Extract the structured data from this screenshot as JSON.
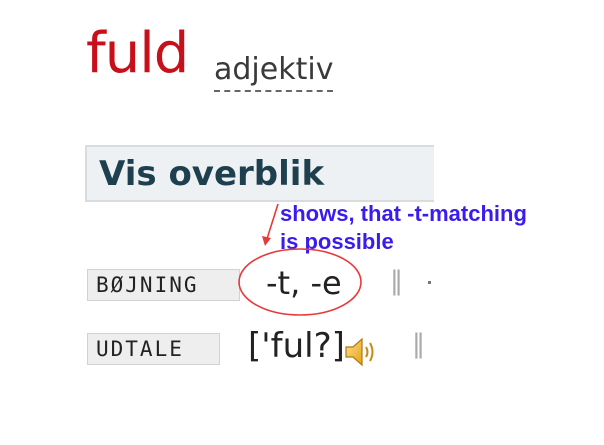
{
  "headword": "fuld",
  "part_of_speech": "adjektiv",
  "overview_button": "Vis overblik",
  "annotation": {
    "line1": "shows, that -t-matching",
    "line2": "is possible"
  },
  "rows": {
    "bojning": {
      "label": "BØJNING",
      "value": "-t, -e"
    },
    "udtale": {
      "label": "UDTALE",
      "value": "['ful?]"
    }
  },
  "icons": {
    "speaker": "speaker-icon",
    "separator": "‖"
  },
  "colors": {
    "headword": "#c8101a",
    "annotation_text": "#3a1cf0",
    "annotation_marks": "#e8393a",
    "overview_text": "#1d3f4e"
  }
}
